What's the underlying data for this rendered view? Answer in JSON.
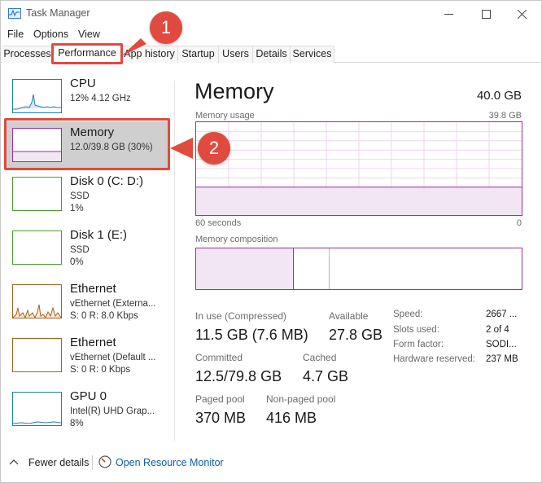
{
  "window": {
    "title": "Task Manager"
  },
  "menu": [
    "File",
    "Options",
    "View"
  ],
  "tabs": [
    {
      "label": "Processes"
    },
    {
      "label": "Performance",
      "active": true
    },
    {
      "label": "App history"
    },
    {
      "label": "Startup"
    },
    {
      "label": "Users"
    },
    {
      "label": "Details"
    },
    {
      "label": "Services"
    }
  ],
  "sidebar": {
    "items": [
      {
        "title": "CPU",
        "line1": "12%  4.12 GHz",
        "line2": "",
        "color": "#1b7fb8"
      },
      {
        "title": "Memory",
        "line1": "12.0/39.8 GB (30%)",
        "line2": "",
        "color": "#9b2ea3",
        "selected": true
      },
      {
        "title": "Disk 0 (C: D:)",
        "line1": "SSD",
        "line2": "1%",
        "color": "#4aa02c"
      },
      {
        "title": "Disk 1 (E:)",
        "line1": "SSD",
        "line2": "0%",
        "color": "#4aa02c"
      },
      {
        "title": "Ethernet",
        "line1": "vEthernet (Externa...",
        "line2": "S: 0  R: 8.0 Kbps",
        "color": "#a7601a"
      },
      {
        "title": "Ethernet",
        "line1": "vEthernet (Default ...",
        "line2": "S: 0  R: 0 Kbps",
        "color": "#a7601a"
      },
      {
        "title": "GPU 0",
        "line1": "Intel(R) UHD Grap...",
        "line2": "8%",
        "color": "#1b7fb8"
      }
    ]
  },
  "main": {
    "title": "Memory",
    "capacity": "40.0 GB",
    "usage_label": "Memory usage",
    "usage_max": "39.8 GB",
    "time_left": "60 seconds",
    "time_right": "0",
    "composition_label": "Memory composition",
    "in_use_label": "In use (Compressed)",
    "in_use_value": "11.5 GB (7.6 MB)",
    "available_label": "Available",
    "available_value": "27.8 GB",
    "committed_label": "Committed",
    "committed_value": "12.5/79.8 GB",
    "cached_label": "Cached",
    "cached_value": "4.7 GB",
    "paged_label": "Paged pool",
    "paged_value": "370 MB",
    "nonpaged_label": "Non-paged pool",
    "nonpaged_value": "416 MB",
    "specs": [
      {
        "key": "Speed:",
        "value": "2667 ..."
      },
      {
        "key": "Slots used:",
        "value": "2 of 4"
      },
      {
        "key": "Form factor:",
        "value": "SODI..."
      },
      {
        "key": "Hardware reserved:",
        "value": "237 MB"
      }
    ],
    "usage_fraction": 0.3
  },
  "footer": {
    "fewer_details": "Fewer details",
    "resource_monitor": "Open Resource Monitor"
  },
  "callouts": [
    "1",
    "2"
  ],
  "colors": {
    "memory": "#9b2ea3",
    "callout": "#e04a3f",
    "link": "#0b5cad"
  }
}
